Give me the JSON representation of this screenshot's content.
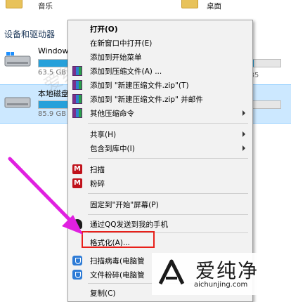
{
  "explorer": {
    "folders": [
      {
        "label": "音乐"
      },
      {
        "label": "桌面"
      }
    ],
    "section_header": "设备和驱动器",
    "drives": [
      {
        "name": "Windows",
        "size_text": "63.5 GB",
        "free_text": "共 585",
        "usage_fraction": 0.89
      },
      {
        "name": "本地磁盘",
        "size_text": "85.9 GB",
        "free_text": "",
        "usage_fraction": 0.35
      }
    ]
  },
  "context_menu": {
    "items": [
      {
        "label": "打开(O)",
        "bold": true,
        "icon": "none"
      },
      {
        "label": "在新窗口中打开(E)",
        "icon": "none"
      },
      {
        "label": "添加到开始菜单",
        "icon": "none"
      },
      {
        "label": "添加到压缩文件(A) ...",
        "icon": "winrar-icon"
      },
      {
        "label": "添加到 \"新建压缩文件.zip\"(T)",
        "icon": "winrar-icon"
      },
      {
        "label": "添加到 \"新建压缩文件.zip\" 并邮件",
        "icon": "winrar-icon"
      },
      {
        "label": "其他压缩命令",
        "icon": "winrar-icon",
        "submenu": true
      },
      {
        "label": "共享(H)",
        "icon": "none",
        "submenu": true
      },
      {
        "label": "包含到库中(I)",
        "icon": "none",
        "submenu": true
      },
      {
        "label": "扫描",
        "icon": "mcafee-icon"
      },
      {
        "label": "粉碎",
        "icon": "mcafee-icon"
      },
      {
        "label": "固定到\"开始\"屏幕(P)",
        "icon": "none"
      },
      {
        "label": "通过QQ发送到我的手机",
        "icon": "qq-icon"
      },
      {
        "label": "格式化(A)...",
        "icon": "none"
      },
      {
        "label": "扫描病毒(电脑管",
        "icon": "shield-icon"
      },
      {
        "label": "文件粉碎(电脑管",
        "icon": "shield-icon"
      },
      {
        "label": "复制(C)",
        "icon": "none"
      }
    ]
  },
  "watermark": {
    "cn_text": "爱纯净",
    "url": "aichunjing.com",
    "faint_text": "爱纯净"
  },
  "colors": {
    "highlight_border": "#e8201a",
    "arrow": "#e020e0",
    "selection": "#cce8ff",
    "drive_bar": "#26a0da"
  }
}
